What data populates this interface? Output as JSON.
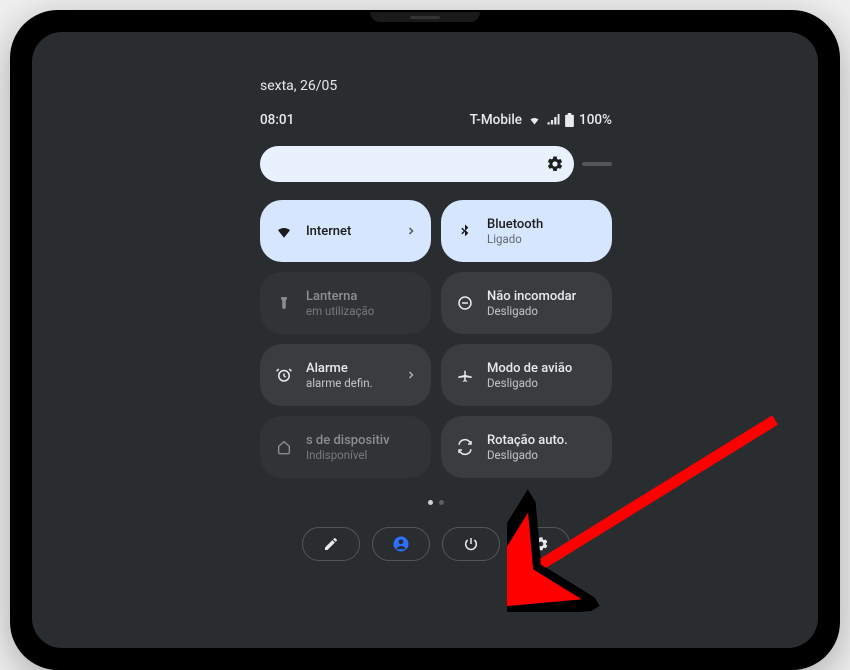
{
  "header": {
    "date": "sexta, 26/05",
    "time": "08:01",
    "carrier": "T-Mobile",
    "battery": "100%"
  },
  "tiles": {
    "internet": {
      "title": "Internet",
      "sub": ""
    },
    "bluetooth": {
      "title": "Bluetooth",
      "sub": "Ligado"
    },
    "flashlight": {
      "title": "Lanterna",
      "sub": "em utilização"
    },
    "dnd": {
      "title": "Não incomodar",
      "sub": "Desligado"
    },
    "alarm": {
      "title": "Alarme",
      "sub": "alarme defin."
    },
    "airplane": {
      "title": "Modo de avião",
      "sub": "Desligado"
    },
    "devices": {
      "title": "s de dispositiv",
      "sub": "Indisponível"
    },
    "rotation": {
      "title": "Rotação auto.",
      "sub": "Desligado"
    }
  },
  "icons": {
    "wifi": "wifi-icon",
    "bluetooth": "bluetooth-icon",
    "flashlight": "flashlight-icon",
    "dnd": "dnd-icon",
    "alarm": "alarm-icon",
    "airplane": "airplane-icon",
    "home": "home-icon",
    "rotation": "rotation-icon",
    "gear": "gear-icon",
    "pencil": "pencil-icon",
    "avatar": "avatar-icon",
    "power": "power-icon",
    "settings": "settings-icon"
  },
  "colors": {
    "active_tile": "#d6e6ff",
    "panel_bg": "#2a2d30",
    "arrow": "#ff0000",
    "avatar_blue": "#2d6fff"
  }
}
